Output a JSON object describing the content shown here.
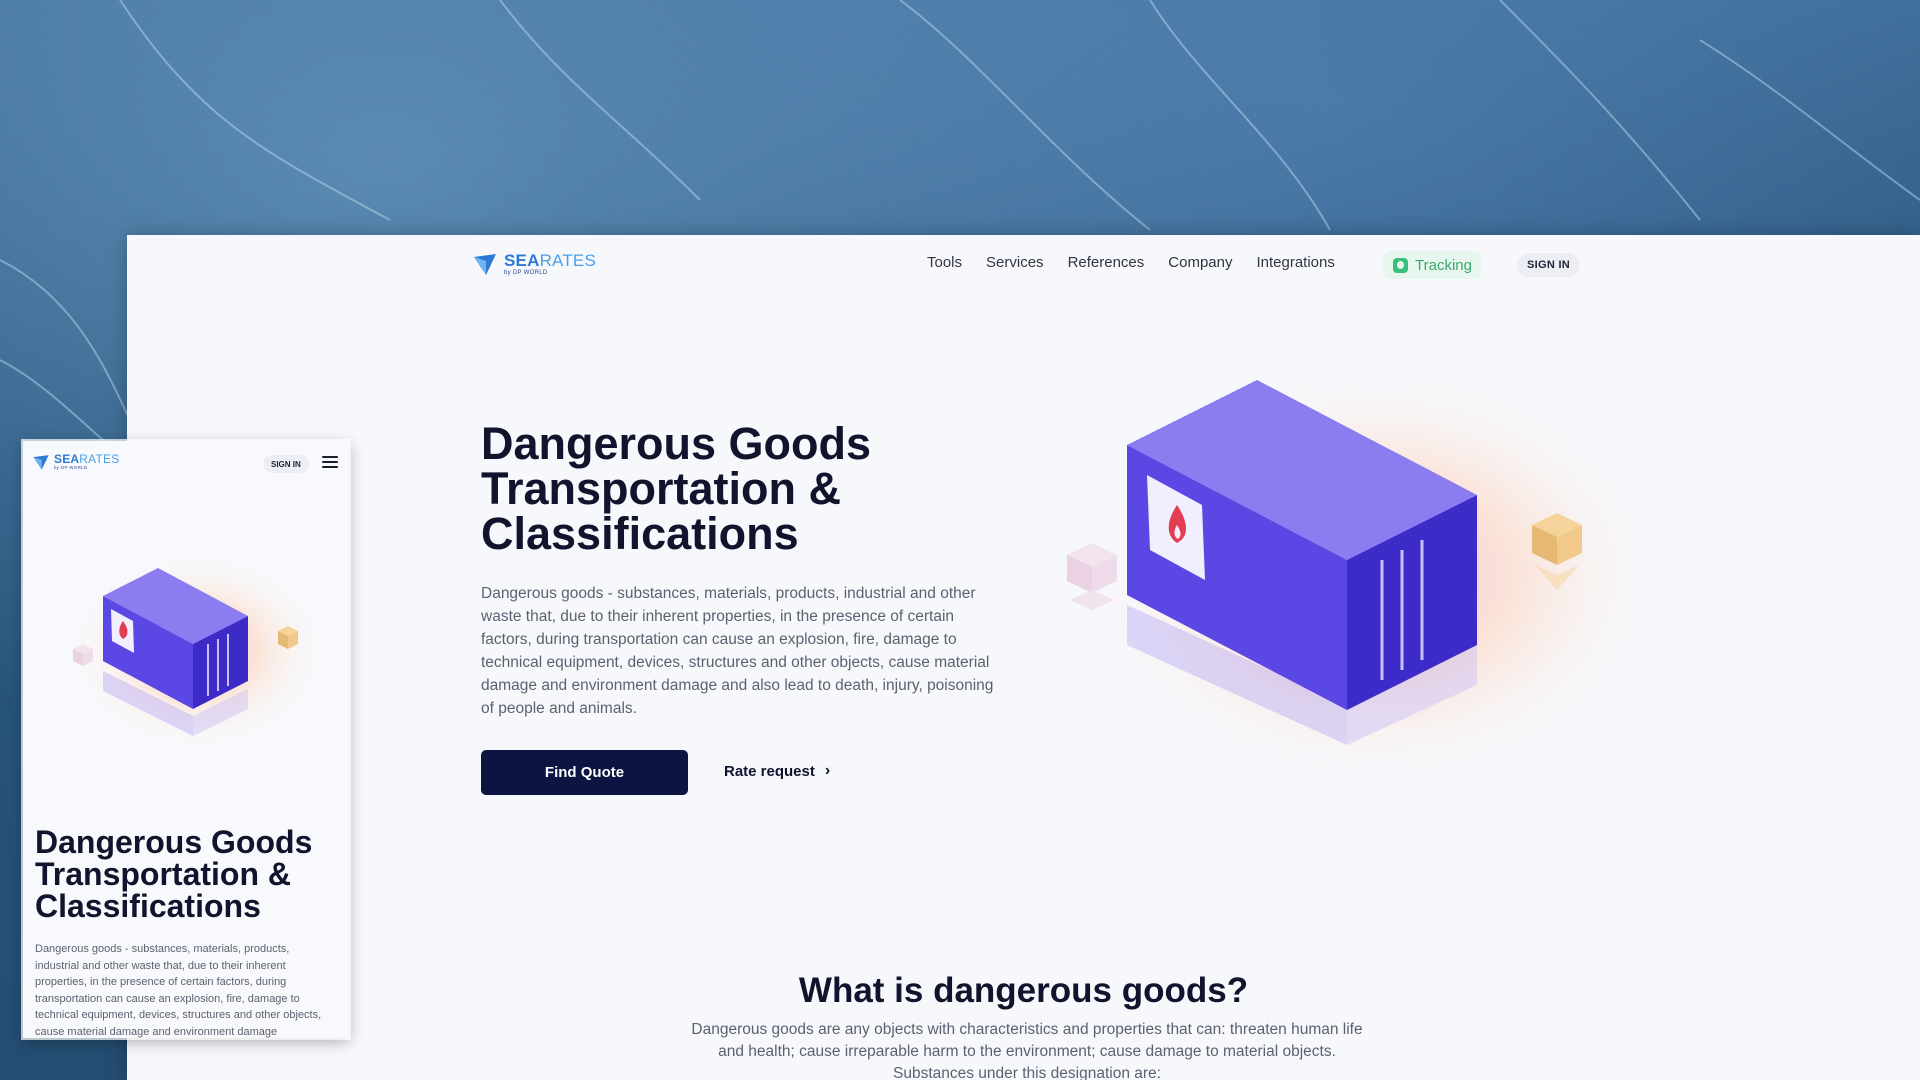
{
  "brand": {
    "name_bold": "SEA",
    "name_light": "RATES",
    "tagline": "by DP WORLD"
  },
  "nav": {
    "links": [
      "Tools",
      "Services",
      "References",
      "Company",
      "Integrations"
    ],
    "tracking_label": "Tracking",
    "signin_label": "SIGN IN"
  },
  "hero": {
    "title": "Dangerous Goods Transportation & Classifications",
    "description": "Dangerous goods - substances, materials, products, industrial and other waste that, due to their inherent properties, in the presence of certain factors, during transportation can cause an explosion, fire, damage to technical equipment, devices, structures and other objects, cause material damage and environment damage and also lead to death, injury, poisoning of people and animals.",
    "primary_button": "Find Quote",
    "secondary_button": "Rate request",
    "secondary_chevron": "›"
  },
  "what": {
    "title": "What is dangerous goods?",
    "text": "Dangerous goods are any objects with characteristics and properties that can: threaten human life and health; cause irreparable harm to the environment; cause damage to material objects. Substances under this designation are:"
  },
  "mobile": {
    "signin_label": "SIGN IN",
    "title": "Dangerous Goods Transportation & Classifications",
    "description": "Dangerous goods - substances, materials, products, industrial and other waste that, due to their inherent properties, in the presence of certain factors, during transportation can cause an explosion, fire, damage to technical equipment, devices, structures and other objects, cause material damage and environment damage"
  },
  "icons": [
    "searates-logo-icon",
    "tracking-icon",
    "chevron-right-icon",
    "hamburger-menu-icon",
    "fire-icon",
    "container-illustration"
  ],
  "colors": {
    "primary_dark": "#0c1442",
    "accent_purple": "#6b4fe8",
    "tracking_green": "#3aa86e",
    "brand_blue": "#2d7ad6"
  }
}
